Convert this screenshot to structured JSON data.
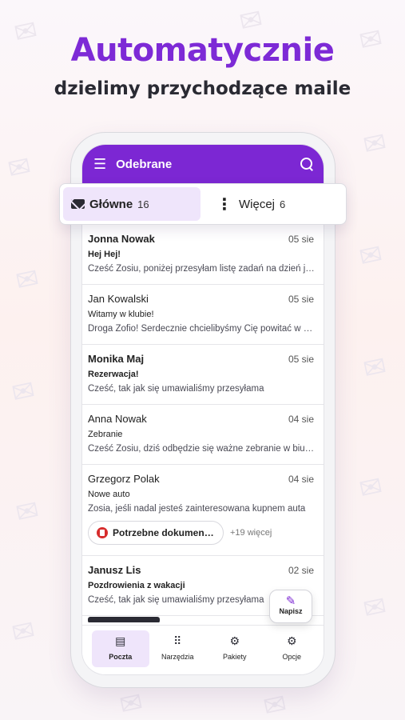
{
  "promo": {
    "headline": "Automatycznie",
    "subheadline": "dzielimy przychodzące maile"
  },
  "appbar": {
    "title": "Odebrane",
    "menu_icon": "hamburger-menu-icon",
    "search_icon": "search-icon"
  },
  "tabs": {
    "main_label": "Główne",
    "main_count": "16",
    "more_label": "Więcej",
    "more_count": "6"
  },
  "mails": [
    {
      "from": "Jonna Nowak",
      "date": "05 sie",
      "subject": "Hej Hej!",
      "preview": "Cześć Zosiu, poniżej przesyłam listę zadań na dzień jutrzejszy",
      "unread": true
    },
    {
      "from": "Jan Kowalski",
      "date": "05 sie",
      "subject": "Witamy w klubie!",
      "preview": "Droga Zofio! Serdecznie chcielibyśmy Cię powitać w naszym klubie",
      "unread": false
    },
    {
      "from": "Monika Maj",
      "date": "05 sie",
      "subject": "Rezerwacja!",
      "preview": "Cześć, tak jak się umawialiśmy przesyłama",
      "unread": true
    },
    {
      "from": "Anna Nowak",
      "date": "04 sie",
      "subject": "Zebranie",
      "preview": "Cześć Zosiu, dziś odbędzie się ważne zebranie w biurze",
      "unread": false
    },
    {
      "from": "Grzegorz Polak",
      "date": "04 sie",
      "subject": "Nowe auto",
      "preview": "Zosia, jeśli nadal jesteś zainteresowana kupnem auta",
      "unread": false,
      "attachment": "Potrzebne dokumenty.pdf",
      "more_attachments": "+19 więcej"
    },
    {
      "from": "Janusz Lis",
      "date": "02 sie",
      "subject": "Pozdrowienia z wakacji",
      "preview": "Cześć, tak jak się umawialiśmy przesyłama",
      "unread": true
    }
  ],
  "fab": {
    "label": "Napisz",
    "icon": "pencil-icon"
  },
  "nav": [
    {
      "label": "Poczta",
      "icon": "inbox-icon",
      "glyph": "▤",
      "active": true
    },
    {
      "label": "Narzędzia",
      "icon": "grid-icon",
      "glyph": "⠿",
      "active": false
    },
    {
      "label": "Pakiety",
      "icon": "packages-icon",
      "glyph": "⚙",
      "active": false
    },
    {
      "label": "Opcje",
      "icon": "gear-icon",
      "glyph": "⚙",
      "active": false
    }
  ],
  "colors": {
    "accent": "#7c27d3",
    "headline": "#7d2ad6"
  }
}
